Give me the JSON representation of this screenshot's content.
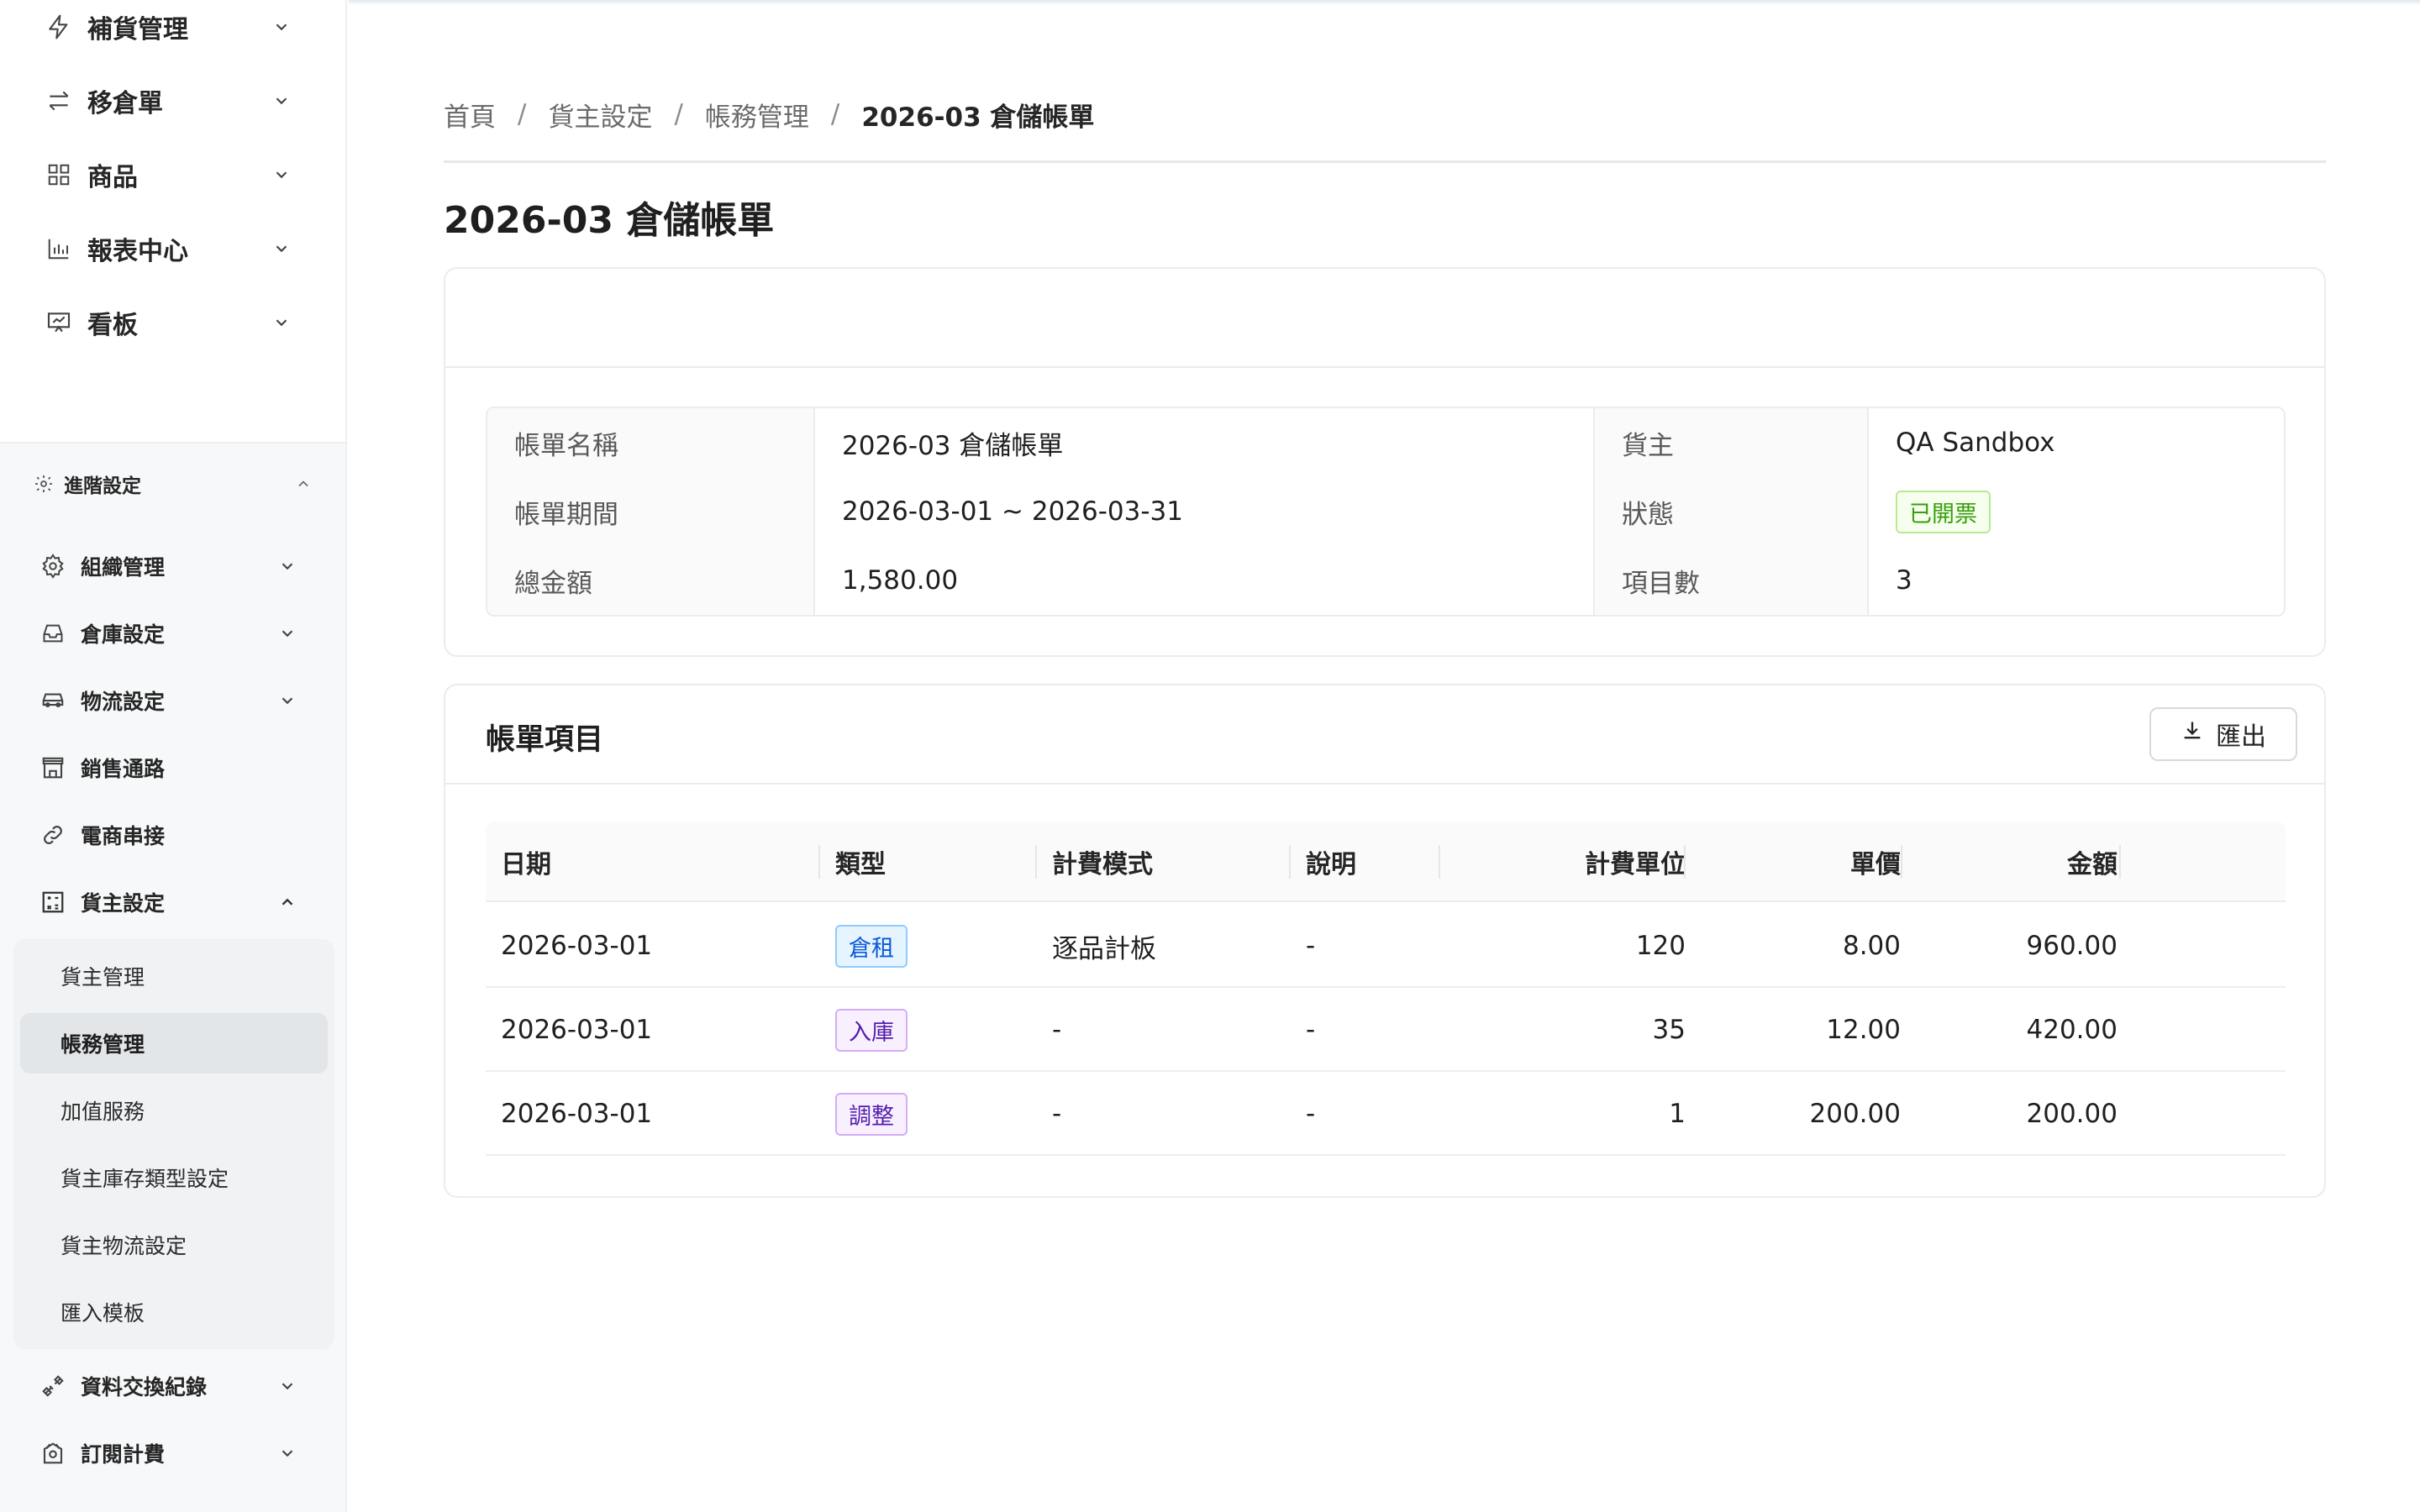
{
  "sidebar": {
    "top_items": [
      {
        "label": "補貨管理",
        "icon": "bolt-icon"
      },
      {
        "label": "移倉單",
        "icon": "transfer-icon"
      },
      {
        "label": "商品",
        "icon": "grid-icon"
      },
      {
        "label": "報表中心",
        "icon": "bar-chart-icon"
      },
      {
        "label": "看板",
        "icon": "presentation-icon"
      }
    ],
    "section_label": "進階設定",
    "section_items": [
      {
        "label": "組織管理",
        "icon": "gear-icon",
        "expandable": true
      },
      {
        "label": "倉庫設定",
        "icon": "inbox-icon",
        "expandable": true
      },
      {
        "label": "物流設定",
        "icon": "car-icon",
        "expandable": true
      },
      {
        "label": "銷售通路",
        "icon": "shop-icon",
        "expandable": false
      },
      {
        "label": "電商串接",
        "icon": "link-icon",
        "expandable": false
      },
      {
        "label": "貨主設定",
        "icon": "calculator-icon",
        "expandable": true,
        "expanded": true
      }
    ],
    "submenu": [
      {
        "label": "貨主管理"
      },
      {
        "label": "帳務管理",
        "active": true
      },
      {
        "label": "加值服務"
      },
      {
        "label": "貨主庫存類型設定"
      },
      {
        "label": "貨主物流設定"
      },
      {
        "label": "匯入模板"
      }
    ],
    "bottom_items": [
      {
        "label": "資料交換紀錄",
        "icon": "api-icon"
      },
      {
        "label": "訂閱計費",
        "icon": "subscription-icon"
      }
    ]
  },
  "breadcrumb": {
    "items": [
      "首頁",
      "貨主設定",
      "帳務管理"
    ],
    "current": "2026-03 倉儲帳單",
    "separator": "/"
  },
  "page_title": "2026-03 倉儲帳單",
  "summary": {
    "rows": [
      {
        "label1": "帳單名稱",
        "value1": "2026-03 倉儲帳單",
        "label2": "貨主",
        "value2": "QA Sandbox"
      },
      {
        "label1": "帳單期間",
        "value1": "2026-03-01 ~ 2026-03-31",
        "label2": "狀態",
        "value2": "已開票"
      },
      {
        "label1": "總金額",
        "value1": "1,580.00",
        "label2": "項目數",
        "value2": "3"
      }
    ]
  },
  "items_card": {
    "title": "帳單項目",
    "export_label": "匯出",
    "columns": [
      "日期",
      "類型",
      "計費模式",
      "說明",
      "計費單位",
      "單價",
      "金額"
    ],
    "rows": [
      {
        "date": "2026-03-01",
        "type": "倉租",
        "type_color": "blue",
        "mode": "逐品計板",
        "desc": "-",
        "units": "120",
        "price": "8.00",
        "amount": "960.00"
      },
      {
        "date": "2026-03-01",
        "type": "入庫",
        "type_color": "purple",
        "mode": "-",
        "desc": "-",
        "units": "35",
        "price": "12.00",
        "amount": "420.00"
      },
      {
        "date": "2026-03-01",
        "type": "調整",
        "type_color": "purple",
        "mode": "-",
        "desc": "-",
        "units": "1",
        "price": "200.00",
        "amount": "200.00"
      }
    ]
  },
  "colors": {
    "status_green": "#389e0d",
    "tag_blue": "#0958d9",
    "tag_purple": "#531dab"
  }
}
